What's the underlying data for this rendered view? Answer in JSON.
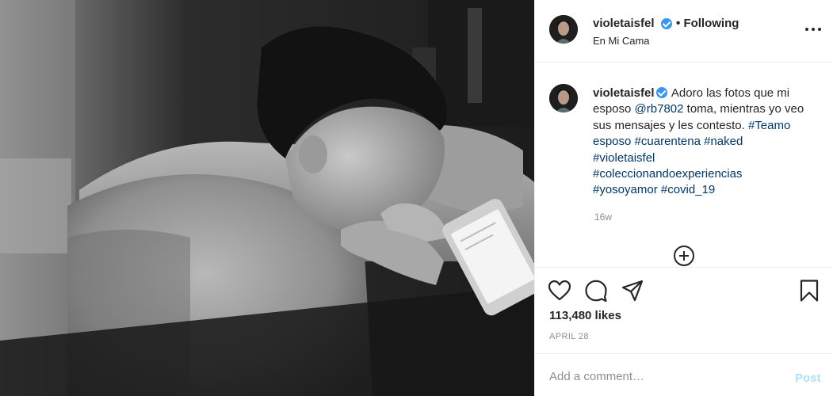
{
  "header": {
    "username": "violetaisfel",
    "separator": "•",
    "follow_status": "Following",
    "location": "En Mi Cama",
    "verified_icon": "verified-badge-icon",
    "more_icon": "more-options-icon"
  },
  "caption": {
    "username": "violetaisfel",
    "text_1": " Adoro las fotos que mi esposo ",
    "mention": "@rb7802",
    "text_2": " toma, mientras yo veo sus mensajes y les contesto. ",
    "hashtags": [
      "#Teamo",
      "esposo",
      "#cuarentena",
      "#naked",
      "#violetaisfel",
      "#coleccionandoexperiencias",
      "#yosoyamor",
      "#covid_19"
    ],
    "time_ago": "16w"
  },
  "actions": {
    "like_icon": "heart-icon",
    "comment_icon": "comment-icon",
    "share_icon": "paper-plane-icon",
    "save_icon": "bookmark-icon",
    "load_more_icon": "plus-circle-icon"
  },
  "stats": {
    "likes": "113,480 likes",
    "date": "APRIL 28"
  },
  "comment": {
    "placeholder": "Add a comment…",
    "post_label": "Post"
  },
  "colors": {
    "link": "#00376b",
    "verified": "#3897f0",
    "post_disabled": "#b2dffc",
    "muted": "#8e8e8e"
  }
}
